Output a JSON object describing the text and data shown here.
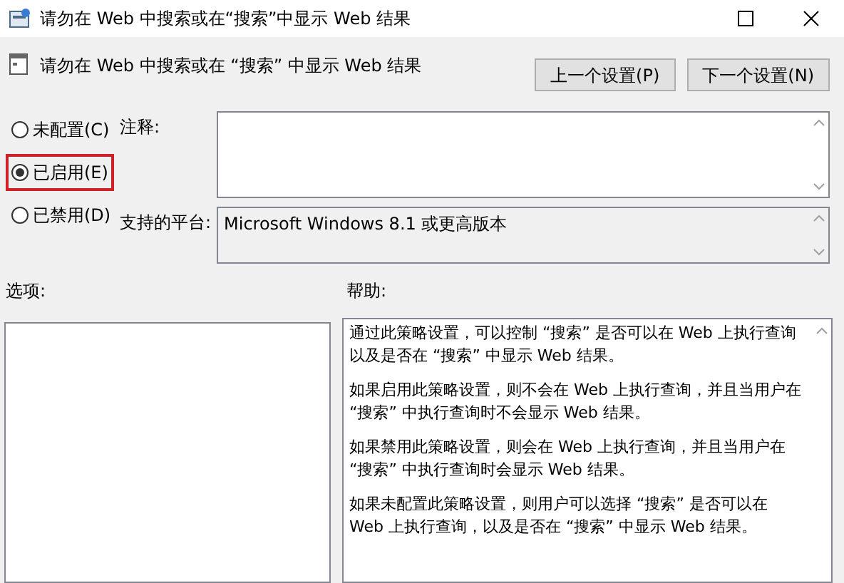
{
  "window": {
    "title": "请勿在 Web 中搜索或在“搜索”中显示 Web 结果"
  },
  "header": {
    "policy_title": "请勿在 Web 中搜索或在 “搜索” 中显示 Web 结果",
    "buttons": [
      "上一个设置(P)",
      "下一个设置(N)"
    ]
  },
  "radios": [
    {
      "label": "未配置(C)",
      "selected": false,
      "highlighted": false
    },
    {
      "label": "已启用(E)",
      "selected": true,
      "highlighted": true
    },
    {
      "label": "已禁用(D)",
      "selected": false,
      "highlighted": false
    }
  ],
  "comment": {
    "label": "注释:"
  },
  "platform": {
    "label": "支持的平台:",
    "value": "Microsoft Windows 8.1 或更高版本"
  },
  "options": {
    "label": "选项:"
  },
  "help": {
    "label": "帮助:",
    "paragraphs": [
      "通过此策略设置，可以控制 “搜索” 是否可以在 Web 上执行查询以及是否在 “搜索” 中显示 Web 结果。",
      "如果启用此策略设置，则不会在 Web 上执行查询，并且当用户在 “搜索” 中执行查询时不会显示 Web 结果。",
      "如果禁用此策略设置，则会在 Web 上执行查询，并且当用户在 “搜索” 中执行查询时会显示 Web 结果。",
      "如果未配置此策略设置，则用户可以选择 “搜索” 是否可以在 Web 上执行查询，以及是否在 “搜索” 中显示 Web 结果。"
    ]
  }
}
